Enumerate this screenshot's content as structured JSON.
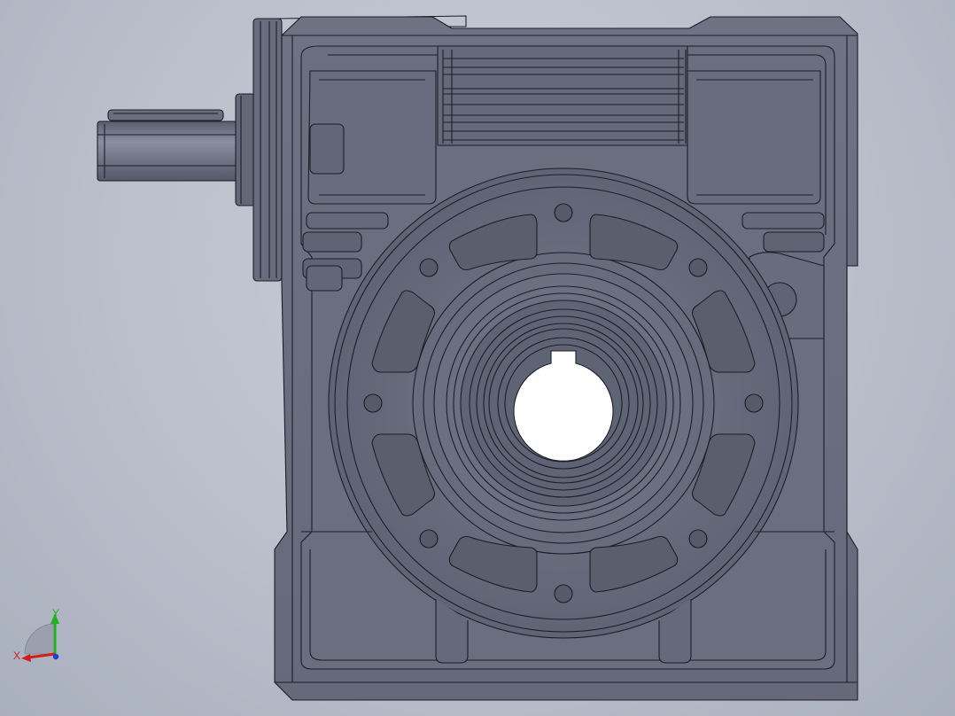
{
  "viewport": {
    "background_top": "#c9ced8",
    "background_bottom": "#a9b0bd"
  },
  "model": {
    "part": "worm-gearbox-housing",
    "view": "front",
    "display_style": "shaded-with-edges",
    "body_color": "#6b7080",
    "face_dark": "#5d6272",
    "face_light": "#7d8292",
    "edge_color": "#1b1e26",
    "bore_color": "#ffffff"
  },
  "triad": {
    "x_label": "X",
    "y_label": "Y",
    "x_color": "#d11c1c",
    "y_color": "#22b022",
    "z_color": "#1c3fd1"
  }
}
